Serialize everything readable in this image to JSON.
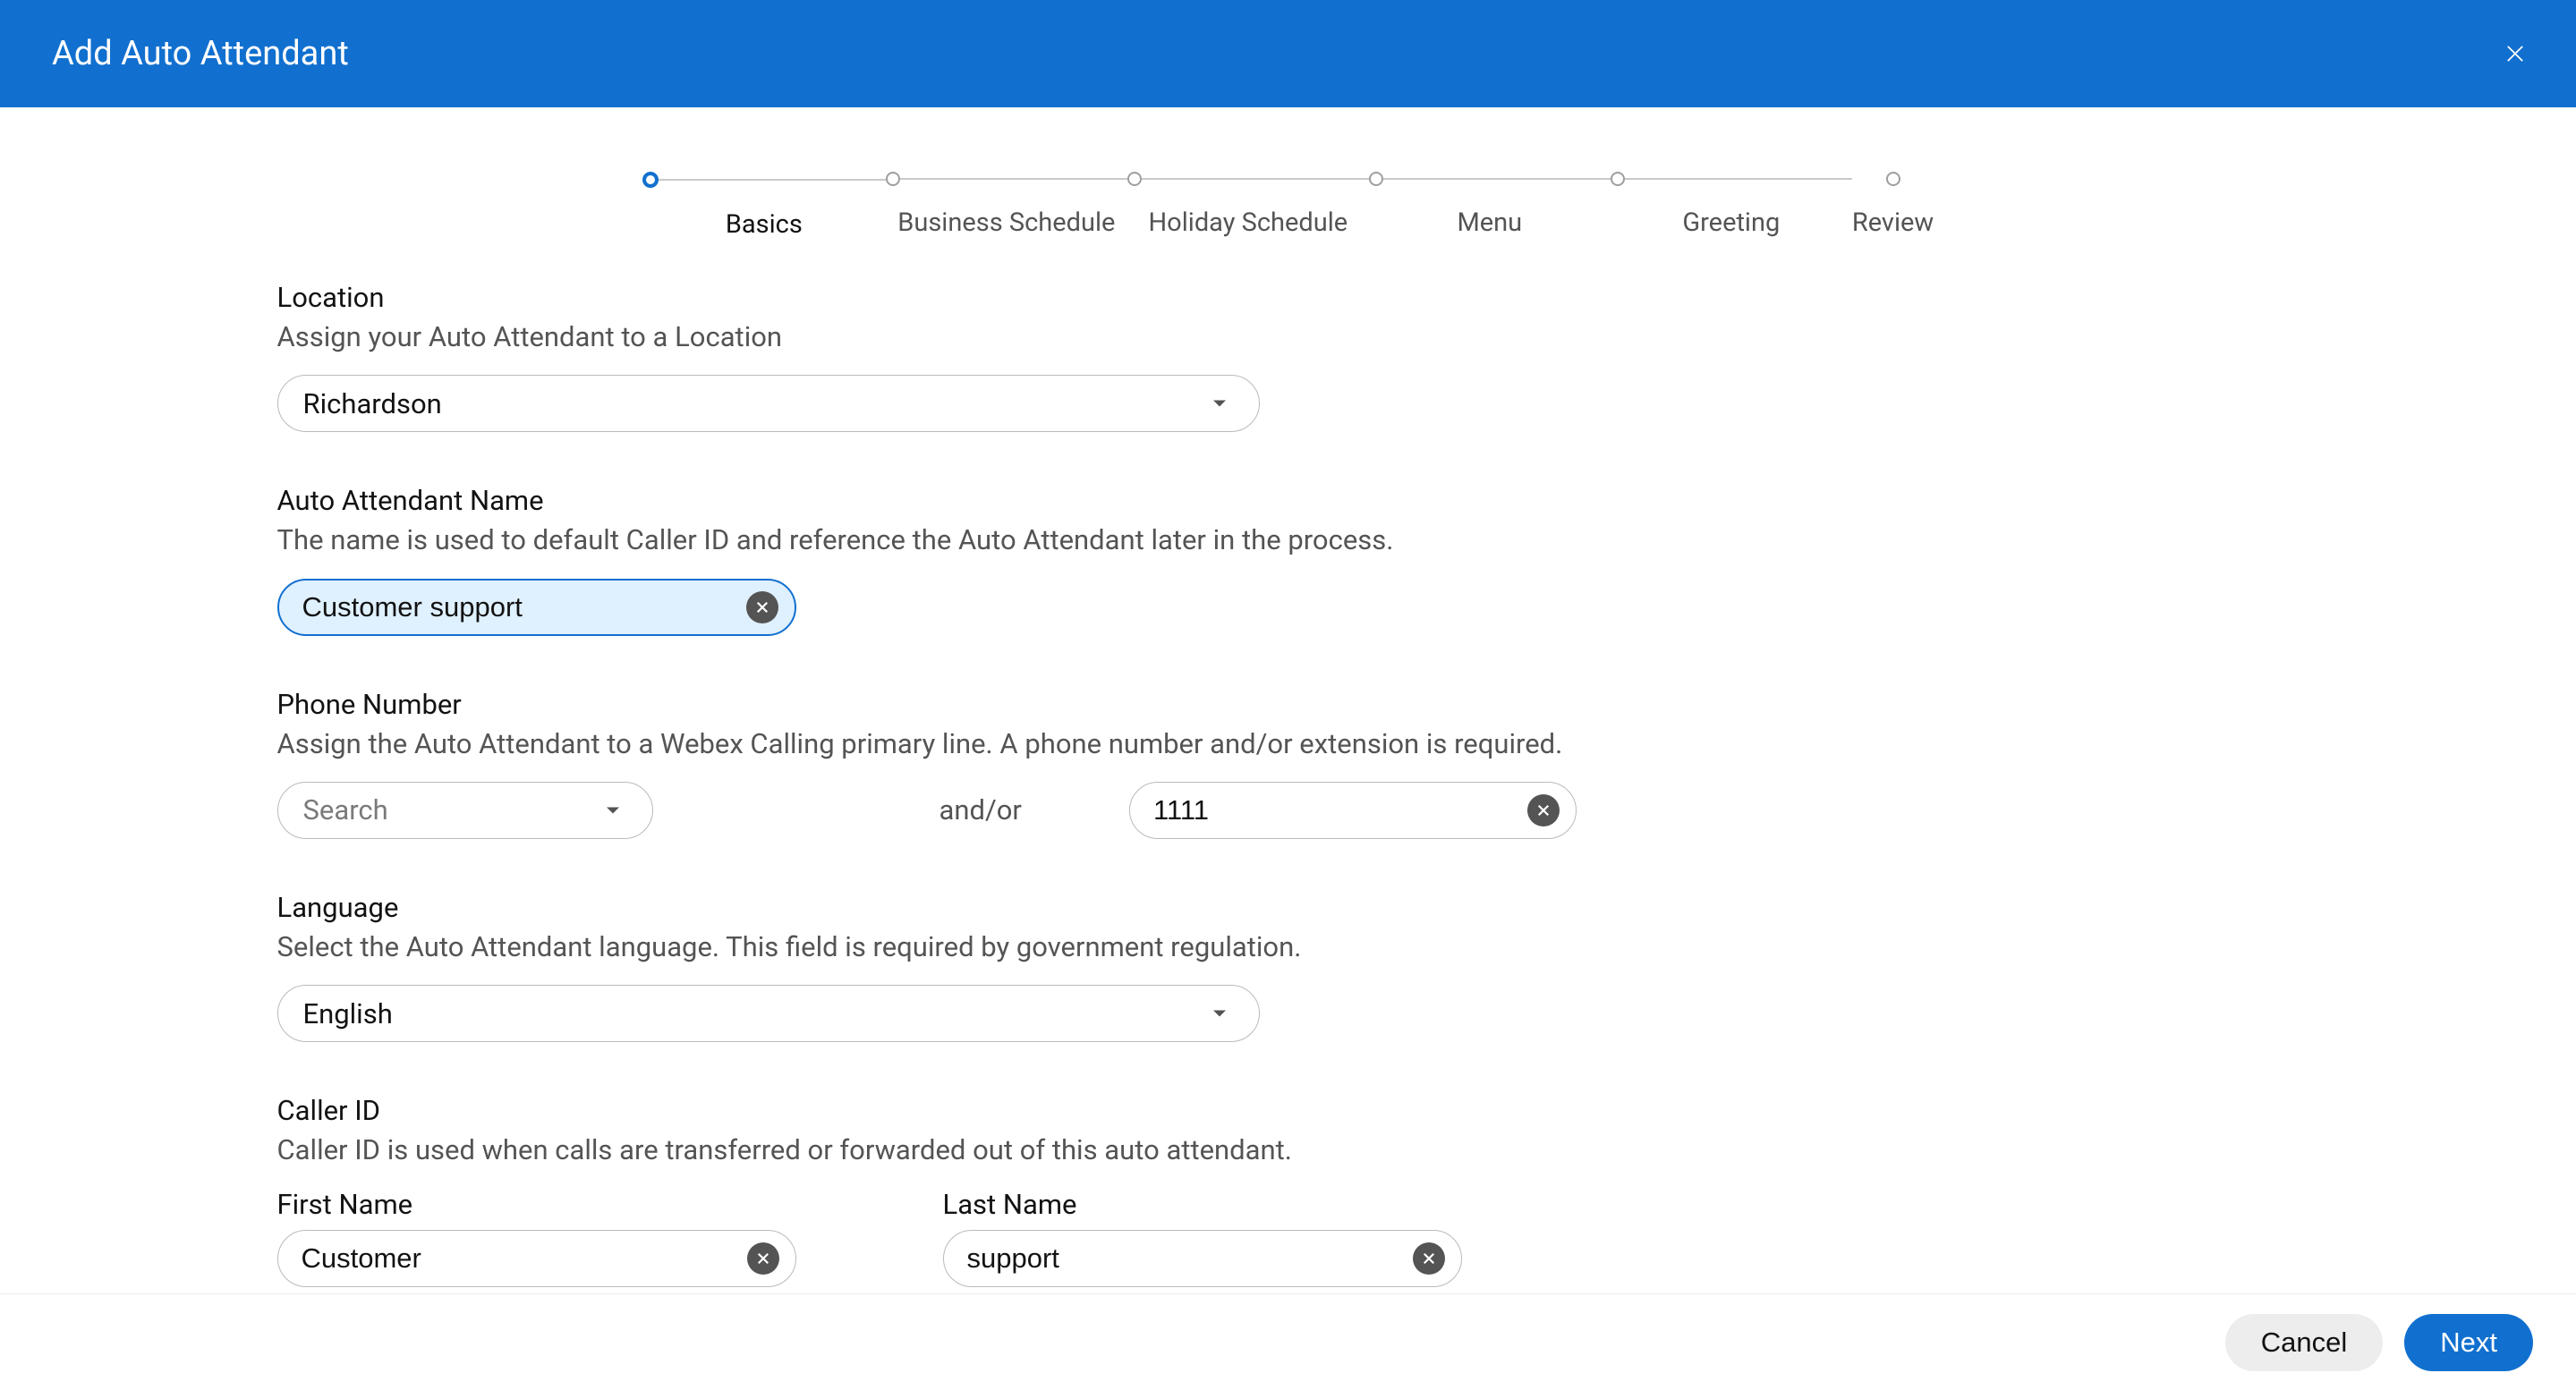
{
  "header": {
    "title": "Add Auto Attendant"
  },
  "steps": [
    {
      "label": "Basics",
      "active": true
    },
    {
      "label": "Business Schedule",
      "active": false
    },
    {
      "label": "Holiday Schedule",
      "active": false
    },
    {
      "label": "Menu",
      "active": false
    },
    {
      "label": "Greeting",
      "active": false
    },
    {
      "label": "Review",
      "active": false
    }
  ],
  "location": {
    "label": "Location",
    "desc": "Assign your Auto Attendant to a Location",
    "value": "Richardson"
  },
  "name": {
    "label": "Auto Attendant Name",
    "desc": "The name is used to default Caller ID and reference the Auto Attendant later in the process.",
    "value": "Customer support"
  },
  "phone": {
    "label": "Phone Number",
    "desc": "Assign the Auto Attendant to a Webex Calling primary line. A phone number and/or extension is required.",
    "search_placeholder": "Search",
    "andor": "and/or",
    "extension_value": "1111"
  },
  "language": {
    "label": "Language",
    "desc": "Select the Auto Attendant language. This field is required by government regulation.",
    "value": "English"
  },
  "callerid": {
    "label": "Caller ID",
    "desc": "Caller ID is used when calls are transferred or forwarded out of this auto attendant.",
    "first_label": "First Name",
    "first_value": "Customer",
    "last_label": "Last Name",
    "last_value": "support"
  },
  "footer": {
    "cancel": "Cancel",
    "next": "Next"
  }
}
